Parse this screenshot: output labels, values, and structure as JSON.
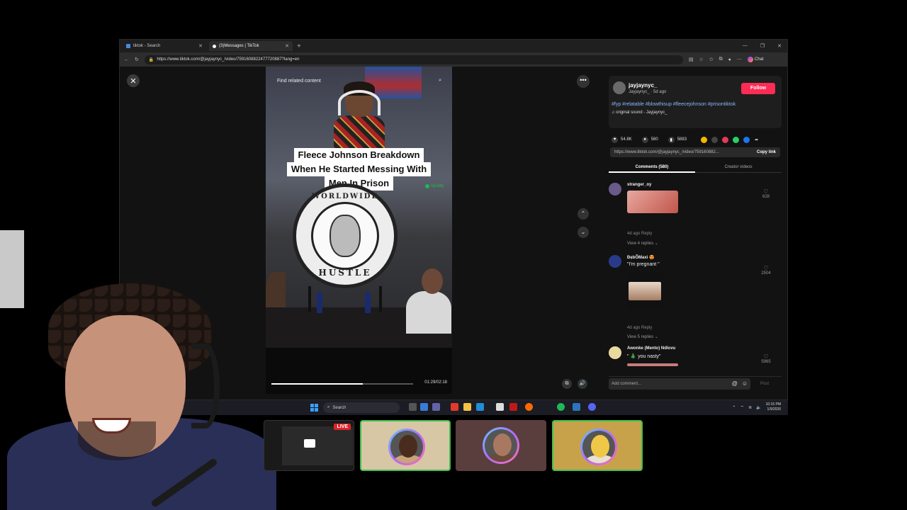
{
  "browser": {
    "tabs": [
      {
        "label": "tiktok - Search",
        "active": false
      },
      {
        "label": "(3)Messages | TikTok",
        "active": true
      }
    ],
    "url": "https://www.tiktok.com/@jayjaynyc_/video/7591608822477720887?lang=en",
    "chat_label": "Chat"
  },
  "video": {
    "find_related": "Find related content",
    "caption_lines": [
      "Fleece Johnson Breakdown",
      "When He Started Messing With",
      "Men In Prison"
    ],
    "seal_top": "WORLDWIDE",
    "seal_bottom": "HUSTLE",
    "spotify_label": "Spotify",
    "time": "01:29/02:18",
    "progress_fraction": 0.645
  },
  "side": {
    "author_name": "jayjaynyc_",
    "author_sub": "Jayjaynyc_ · 5d ago",
    "follow_label": "Follow",
    "hashtags": "#fyp #relatable #blowthisup #fleecejohnson #prisontiktok",
    "sound": "original sound - Jayjaynyc_",
    "likes": "54.8K",
    "comments_count": "580",
    "saves": "5883",
    "link": "https://www.tiktok.com/@jayjaynyc_/video/759160882...",
    "copy_link": "Copy link",
    "tab_comments": "Comments (580)",
    "tab_creator": "Creator videos",
    "comments": [
      {
        "user": "stranger_oy",
        "text": "",
        "meta": "4d ago   Reply",
        "replies": "View 4 replies ⌄",
        "likes": "628"
      },
      {
        "user": "ĐẹbÕMaxi 😍",
        "text": "\"I'm pregnant \"",
        "meta": "4d ago   Reply",
        "replies": "View 5 replies ⌄",
        "likes": "2504"
      },
      {
        "user": "Awonke (Mento) Ndlovu",
        "text": "\" 🎄 you nasty\"",
        "meta": "",
        "replies": "",
        "likes": "5965"
      }
    ],
    "add_comment": "Add comment...",
    "post_label": "Post"
  },
  "taskbar": {
    "search_label": "Search",
    "time": "10:15 PM",
    "date": "1/9/2026"
  },
  "stream": {
    "live_label": "LIVE"
  },
  "colors": {
    "follow": "#fe2c55",
    "live": "#e0212c",
    "speaking_border": "#3fbf52"
  }
}
